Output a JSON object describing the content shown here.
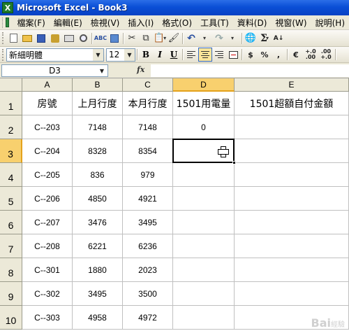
{
  "window": {
    "title": "Microsoft Excel - Book3",
    "app_icon": "X"
  },
  "menu": {
    "items": [
      "檔案(F)",
      "編輯(E)",
      "檢視(V)",
      "插入(I)",
      "格式(O)",
      "工具(T)",
      "資料(D)",
      "視窗(W)",
      "說明(H)"
    ]
  },
  "format_bar": {
    "font_name": "新細明體",
    "font_size": "12",
    "bold": "B",
    "italic": "I",
    "underline": "U",
    "currency": "$",
    "percent": "%",
    "comma": ",",
    "euro": "€",
    "inc_decimal": "+.0 .00",
    "dec_decimal": ".00 +.0"
  },
  "formula_bar": {
    "name_box": "D3",
    "fx": "fx",
    "formula": ""
  },
  "sheet": {
    "columns": [
      "A",
      "B",
      "C",
      "D",
      "E"
    ],
    "selected_column": "D",
    "selected_row": "3",
    "active_cell": "D3",
    "rows": [
      {
        "num": "1",
        "cells": [
          "房號",
          "上月行度",
          "本月行度",
          "1501用電量",
          "1501超額自付金額"
        ]
      },
      {
        "num": "2",
        "cells": [
          "C--203",
          "7148",
          "7148",
          "0",
          ""
        ]
      },
      {
        "num": "3",
        "cells": [
          "C--204",
          "8328",
          "8354",
          "",
          ""
        ]
      },
      {
        "num": "4",
        "cells": [
          "C--205",
          "836",
          "979",
          "",
          ""
        ]
      },
      {
        "num": "5",
        "cells": [
          "C--206",
          "4850",
          "4921",
          "",
          ""
        ]
      },
      {
        "num": "6",
        "cells": [
          "C--207",
          "3476",
          "3495",
          "",
          ""
        ]
      },
      {
        "num": "7",
        "cells": [
          "C--208",
          "6221",
          "6236",
          "",
          ""
        ]
      },
      {
        "num": "8",
        "cells": [
          "C--301",
          "1880",
          "2023",
          "",
          ""
        ]
      },
      {
        "num": "9",
        "cells": [
          "C--302",
          "3495",
          "3500",
          "",
          ""
        ]
      },
      {
        "num": "10",
        "cells": [
          "C--303",
          "4958",
          "4972",
          "",
          ""
        ]
      }
    ]
  },
  "watermark": {
    "brand": "Bai",
    "suffix": "經驗"
  }
}
